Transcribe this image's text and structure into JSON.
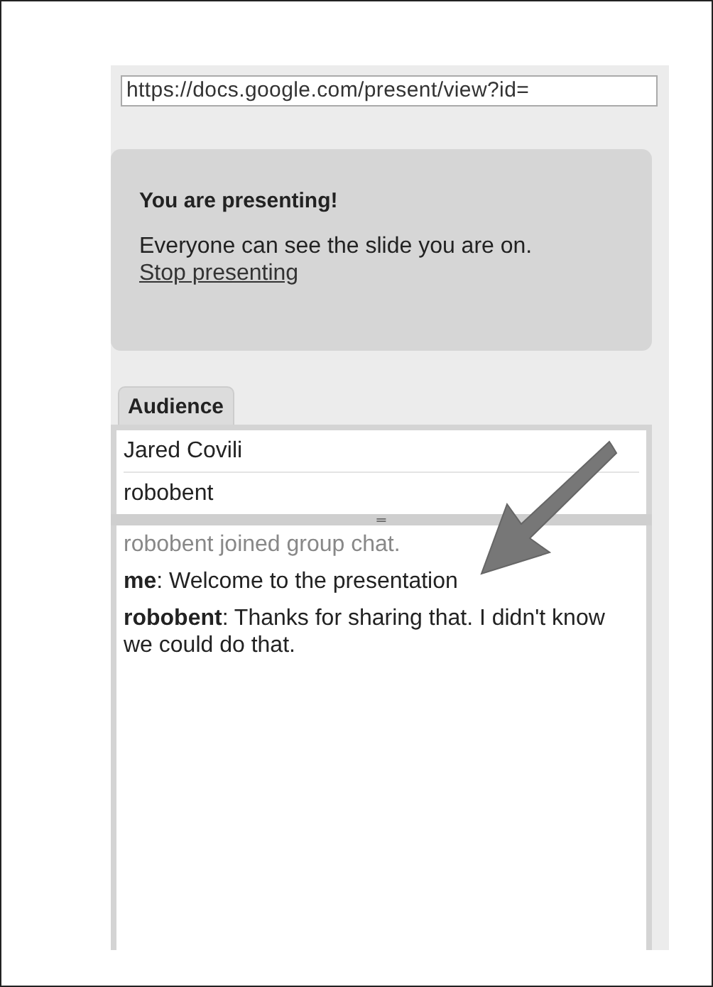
{
  "url_field": {
    "value": "https://docs.google.com/present/view?id="
  },
  "notice": {
    "title": "You are presenting!",
    "text": "Everyone can see the slide you are on.",
    "link": "Stop presenting"
  },
  "tabs": [
    {
      "label": "Audience",
      "selected": true
    }
  ],
  "audience": [
    "Jared Covili",
    "robobent"
  ],
  "splitter": {
    "label": "═"
  },
  "chat": [
    {
      "kind": "system",
      "text": "robobent joined group chat."
    },
    {
      "kind": "message",
      "text": "**me**: Welcome to the presentation"
    },
    {
      "kind": "message",
      "text": "**robobent**: Thanks for sharing that. I didn't know we could do that."
    }
  ]
}
